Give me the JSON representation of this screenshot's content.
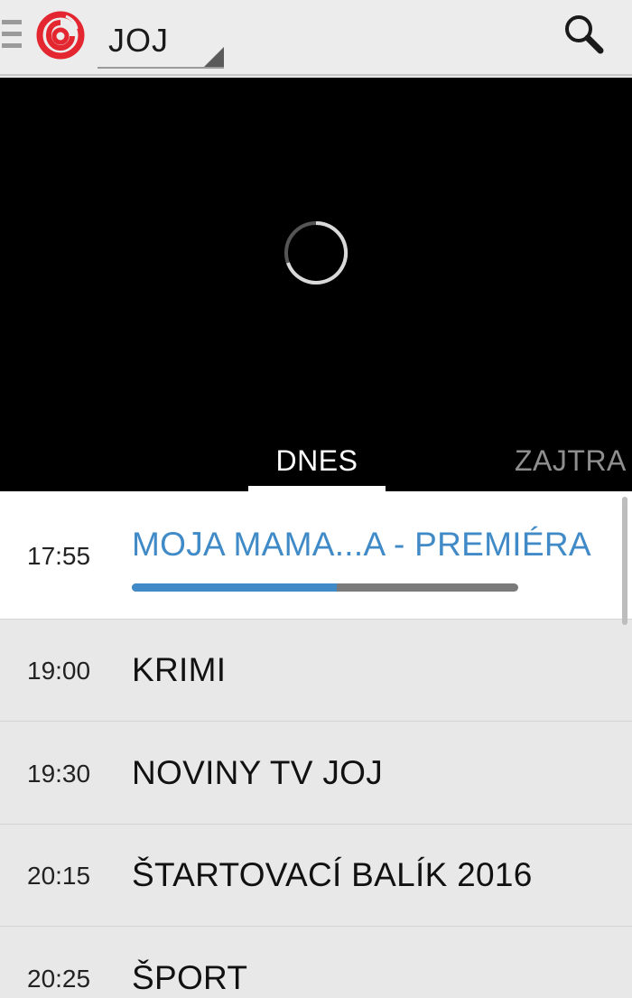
{
  "header": {
    "channel": "JOJ",
    "icons": {
      "drawer": "drawer-icon",
      "logo": "joj-logo-icon",
      "search": "search-icon"
    }
  },
  "player": {
    "state_icon": "loading-spinner-icon"
  },
  "tabs": [
    {
      "label": "DNES",
      "active": true
    },
    {
      "label": "ZAJTRA",
      "active": false
    }
  ],
  "schedule": [
    {
      "time": "17:55",
      "title": "MOJA MAMA...A - PREMIÉRA",
      "current": true,
      "progress": 0.53
    },
    {
      "time": "19:00",
      "title": "KRIMI"
    },
    {
      "time": "19:30",
      "title": "NOVINY TV JOJ"
    },
    {
      "time": "20:15",
      "title": "ŠTARTOVACÍ BALÍK 2016"
    },
    {
      "time": "20:25",
      "title": "ŠPORT"
    }
  ],
  "colors": {
    "accent": "#3f8ac7",
    "logo_red": "#e3262f"
  }
}
